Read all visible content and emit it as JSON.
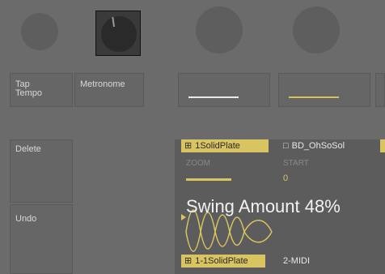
{
  "buttons": {
    "tap_tempo": "Tap\nTempo",
    "metronome": "Metronome",
    "delete": "Delete",
    "undo": "Undo"
  },
  "display": {
    "tabs": [
      {
        "label": "1SolidPlate",
        "icon": "grid-icon"
      },
      {
        "label": "BD_OhSoSol",
        "icon": "square-icon"
      }
    ],
    "params": {
      "zoom_label": "ZOOM",
      "start_label": "START",
      "start_value": "0"
    },
    "overlay": "Swing Amount 48%",
    "bottom_tabs": [
      {
        "label": "1-1SolidPlate",
        "icon": "grid-icon"
      },
      {
        "label": "2-MIDI"
      }
    ]
  },
  "colors": {
    "accent": "#d9c462",
    "background": "#6b6b6b"
  }
}
